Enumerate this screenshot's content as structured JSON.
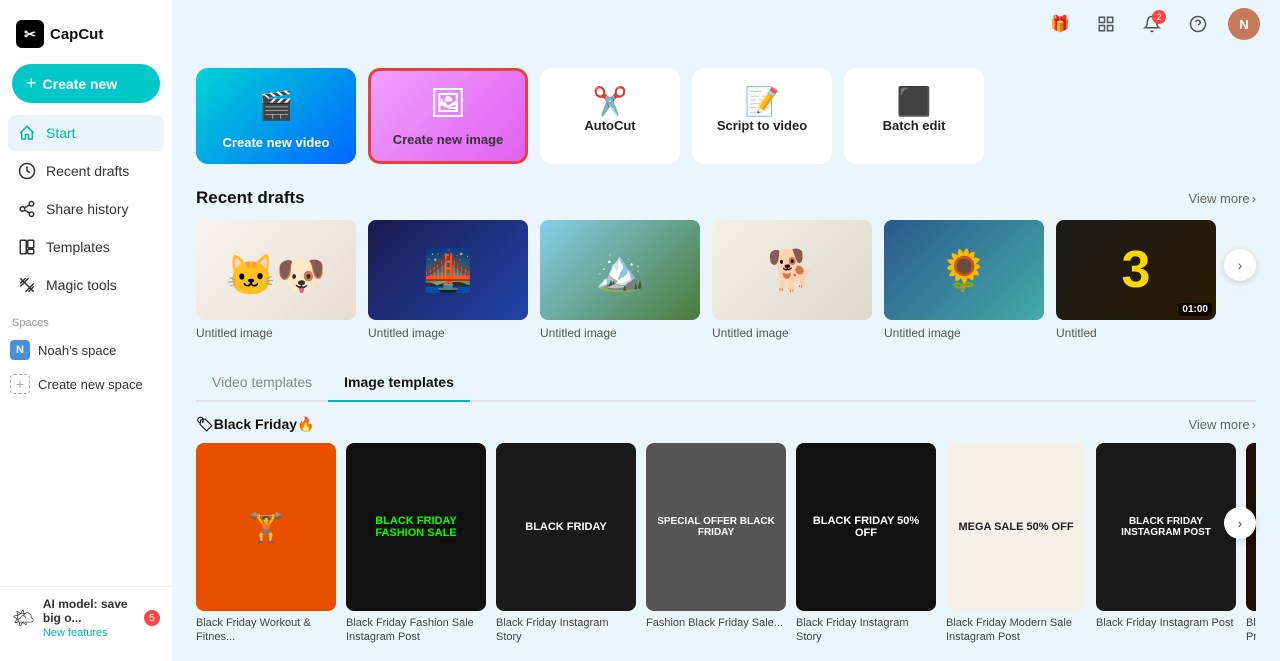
{
  "app": {
    "name": "CapCut",
    "logo_text": "CapCut"
  },
  "sidebar": {
    "create_btn": "Create new",
    "nav_items": [
      {
        "id": "start",
        "label": "Start",
        "active": true
      },
      {
        "id": "recent-drafts",
        "label": "Recent drafts"
      },
      {
        "id": "share-history",
        "label": "Share history"
      },
      {
        "id": "templates",
        "label": "Templates"
      },
      {
        "id": "magic-tools",
        "label": "Magic tools"
      }
    ],
    "spaces_label": "Spaces",
    "spaces": [
      {
        "id": "noah",
        "label": "Noah's space",
        "initial": "N"
      },
      {
        "id": "create-space",
        "label": "Create new space"
      }
    ]
  },
  "topbar": {
    "gift_icon": "🎁",
    "notification_count": "2",
    "bell_icon": "🔔",
    "help_icon": "?"
  },
  "action_cards": [
    {
      "id": "create-video",
      "label": "Create new video"
    },
    {
      "id": "create-image",
      "label": "Create new image"
    },
    {
      "id": "autocut",
      "label": "AutoCut"
    },
    {
      "id": "script-to-video",
      "label": "Script to video"
    },
    {
      "id": "batch-edit",
      "label": "Batch edit"
    }
  ],
  "recent_drafts": {
    "title": "Recent drafts",
    "view_more": "View more",
    "items": [
      {
        "id": "d1",
        "label": "Untitled image",
        "type": "image"
      },
      {
        "id": "d2",
        "label": "Untitled image",
        "type": "image"
      },
      {
        "id": "d3",
        "label": "Untitled image",
        "type": "image"
      },
      {
        "id": "d4",
        "label": "Untitled image",
        "type": "image"
      },
      {
        "id": "d5",
        "label": "Untitled image",
        "type": "image"
      },
      {
        "id": "d6",
        "label": "Untitled",
        "type": "video",
        "duration": "01:00"
      }
    ]
  },
  "templates": {
    "tabs": [
      {
        "id": "video",
        "label": "Video templates"
      },
      {
        "id": "image",
        "label": "Image templates",
        "active": true
      }
    ],
    "sections": [
      {
        "id": "black-friday",
        "title": "🏷Black Friday🔥",
        "view_more": "View more",
        "items": [
          {
            "id": "t1",
            "label": "Black Friday Workout & Fitnes..."
          },
          {
            "id": "t2",
            "label": "Black Friday Fashion Sale Instagram Post"
          },
          {
            "id": "t3",
            "label": "Black Friday Instagram Story"
          },
          {
            "id": "t4",
            "label": "Fashion Black Friday Sale..."
          },
          {
            "id": "t5",
            "label": "Black Friday Instagram Story"
          },
          {
            "id": "t6",
            "label": "Black Friday Modern Sale Instagram Post"
          },
          {
            "id": "t7",
            "label": "Black Friday Instagram Post"
          },
          {
            "id": "t8",
            "label": "Black Friday Shoes Promotions..."
          }
        ]
      }
    ]
  },
  "ai_notification": {
    "text": "AI model: save big o...",
    "sub": "New features",
    "badge": "5"
  }
}
